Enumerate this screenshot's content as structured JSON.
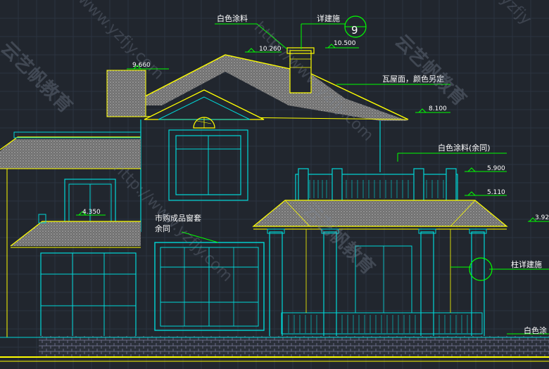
{
  "annotations": {
    "white_paint_top": "白色涂料",
    "detail_ref_top": "详建施",
    "detail_number": "9",
    "tile_roof": "瓦屋面，颜色另定",
    "white_paint_rest": "白色涂料(余同)",
    "window_frame": "市购成品窗套",
    "window_frame_rest": "余同",
    "column_detail": "柱详建施",
    "white_paint_right": "白色涂"
  },
  "levels": {
    "l10260": "10.260",
    "l10500": "10.500",
    "l9660": "9.660",
    "l8100": "8.100",
    "l5900": "5.900",
    "l5110": "5.110",
    "l4350": "4.350",
    "l392": "3.92"
  },
  "watermark": {
    "brand": "云艺帆教育",
    "url": "http://www.yzfjy.com"
  },
  "colors": {
    "background": "#21262e",
    "roof_outline": "#ffff00",
    "wall_outline": "#00d7d7",
    "leader_green": "#00ff00",
    "dimension_green": "#4cff4c",
    "roof_tile": "#9e9e9e"
  }
}
